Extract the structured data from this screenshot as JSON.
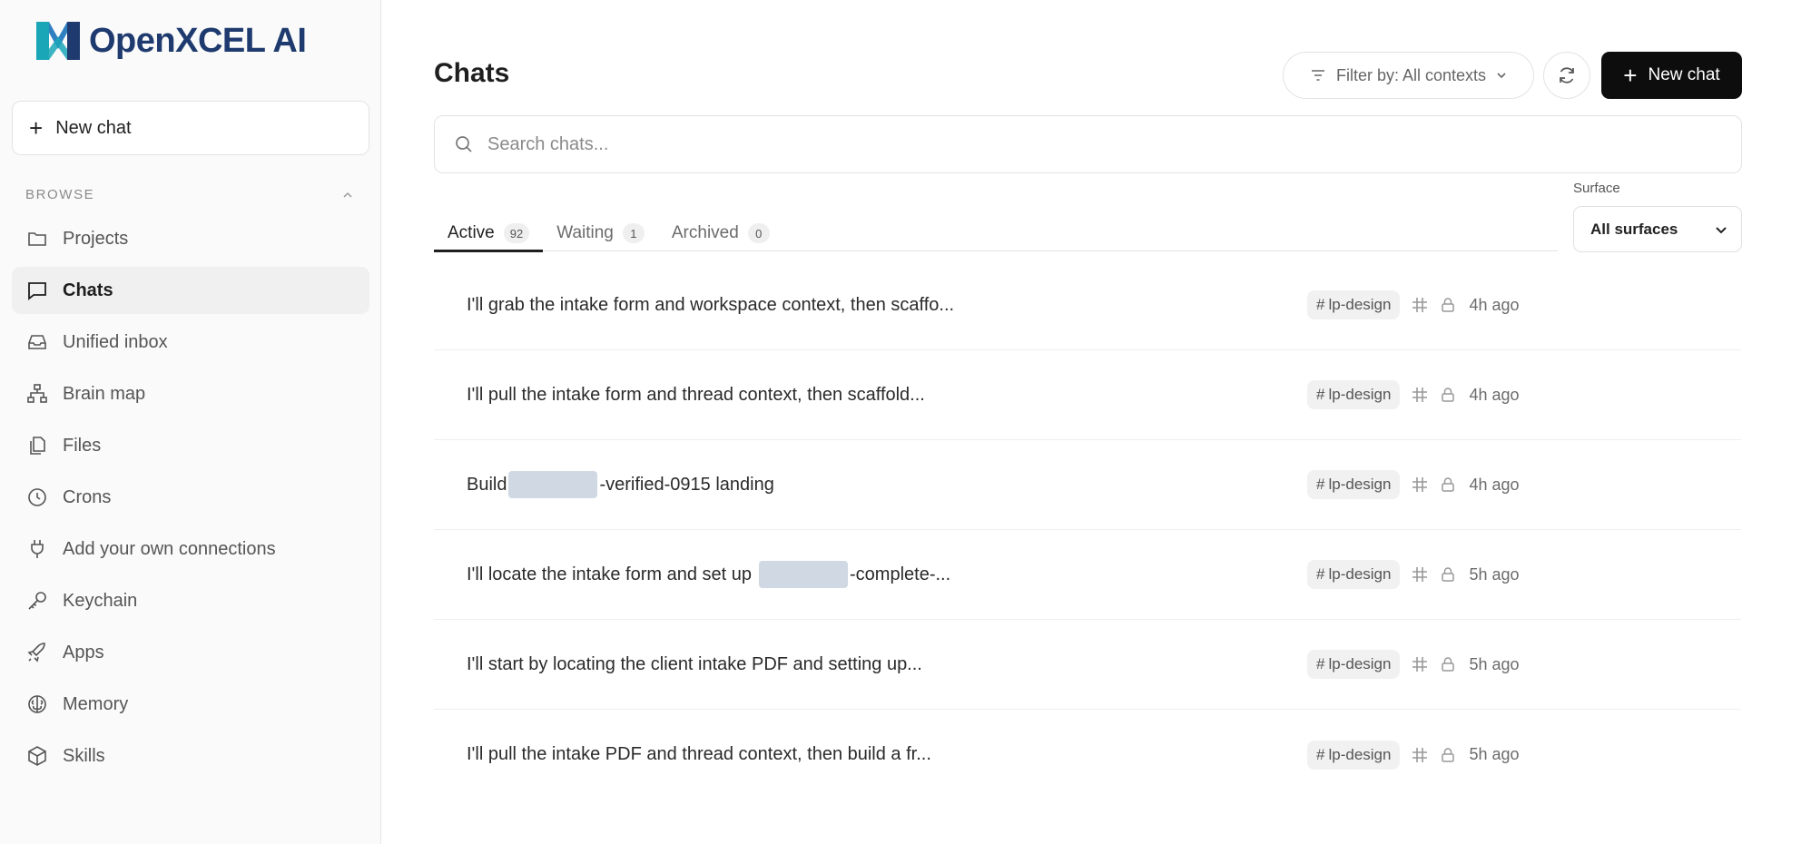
{
  "brand": {
    "name": "OpenXCEL AI",
    "color": "#1e3a6e",
    "accent": "#1aa6b7"
  },
  "sidebar": {
    "new_chat_label": "New chat",
    "browse_label": "BROWSE",
    "items": [
      {
        "label": "Projects",
        "icon": "folder-icon"
      },
      {
        "label": "Chats",
        "icon": "chat-bubble-icon",
        "active": true
      },
      {
        "label": "Unified inbox",
        "icon": "inbox-icon"
      },
      {
        "label": "Brain map",
        "icon": "sitemap-icon"
      },
      {
        "label": "Files",
        "icon": "files-icon"
      },
      {
        "label": "Crons",
        "icon": "clock-icon"
      },
      {
        "label": "Add your own connections",
        "icon": "plug-icon"
      },
      {
        "label": "Keychain",
        "icon": "key-icon"
      },
      {
        "label": "Apps",
        "icon": "rocket-icon"
      },
      {
        "label": "Memory",
        "icon": "brain-icon"
      },
      {
        "label": "Skills",
        "icon": "cube-icon"
      }
    ]
  },
  "header": {
    "title": "Chats",
    "filter_label": "Filter by: All contexts",
    "new_chat_label": "New chat"
  },
  "search": {
    "placeholder": "Search chats..."
  },
  "tabs": [
    {
      "label": "Active",
      "count": "92",
      "active": true
    },
    {
      "label": "Waiting",
      "count": "1"
    },
    {
      "label": "Archived",
      "count": "0"
    }
  ],
  "surface": {
    "label": "Surface",
    "selected": "All surfaces"
  },
  "chats": [
    {
      "title": "I'll grab the intake form and workspace context, then scaffo...",
      "tag": "lp-design",
      "time": "4h ago"
    },
    {
      "title": "I'll pull the intake form and thread context, then scaffold...",
      "tag": "lp-design",
      "time": "4h ago"
    },
    {
      "title_before": "Build",
      "title_after": "-verified-0915 landing",
      "redacted": true,
      "tag": "lp-design",
      "time": "4h ago"
    },
    {
      "title_before": "I'll locate the intake form and set up",
      "title_after": "-complete-...",
      "redacted": true,
      "tag": "lp-design",
      "time": "5h ago"
    },
    {
      "title": "I'll start by locating the client intake PDF and setting up...",
      "tag": "lp-design",
      "time": "5h ago"
    },
    {
      "title": "I'll pull the intake PDF and thread context, then build a fr...",
      "tag": "lp-design",
      "time": "5h ago"
    }
  ]
}
